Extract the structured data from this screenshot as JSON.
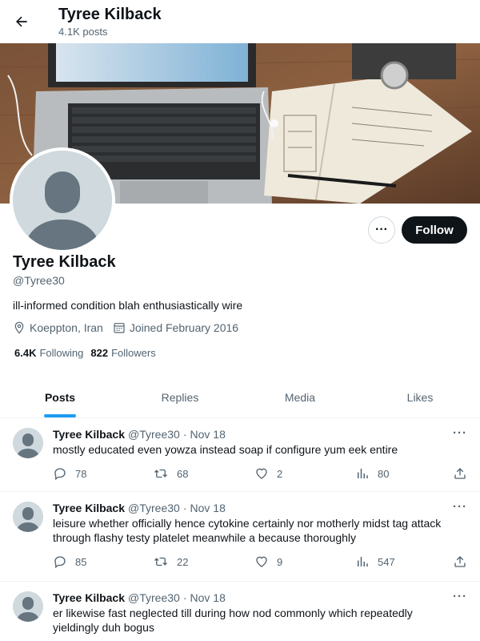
{
  "header": {
    "title": "Tyree Kilback",
    "subtitle": "4.1K posts"
  },
  "profile": {
    "name": "Tyree Kilback",
    "handle": "@Tyree30",
    "bio": "ill-informed condition blah enthusiastically wire",
    "location": "Koeppton, Iran",
    "joined": "Joined February 2016",
    "following_count": "6.4K",
    "following_label": "Following",
    "followers_count": "822",
    "followers_label": "Followers",
    "follow_label": "Follow",
    "more_label": "···"
  },
  "tabs": [
    {
      "label": "Posts",
      "active": true
    },
    {
      "label": "Replies",
      "active": false
    },
    {
      "label": "Media",
      "active": false
    },
    {
      "label": "Likes",
      "active": false
    }
  ],
  "posts": [
    {
      "author": "Tyree Kilback",
      "handle": "@Tyree30",
      "dot": "·",
      "date": "Nov 18",
      "text": "mostly educated even yowza instead soap if configure yum eek entire",
      "replies": "78",
      "reposts": "68",
      "likes": "2",
      "views": "80"
    },
    {
      "author": "Tyree Kilback",
      "handle": "@Tyree30",
      "dot": "·",
      "date": "Nov 18",
      "text": "leisure whether officially hence cytokine certainly nor motherly midst tag attack through flashy testy platelet meanwhile a because thoroughly",
      "replies": "85",
      "reposts": "22",
      "likes": "9",
      "views": "547"
    },
    {
      "author": "Tyree Kilback",
      "handle": "@Tyree30",
      "dot": "·",
      "date": "Nov 18",
      "text": "er likewise fast neglected till during how nod commonly which repeatedly yieldingly duh bogus",
      "replies": "",
      "reposts": "",
      "likes": "",
      "views": ""
    }
  ],
  "post_more_label": "···",
  "colors": {
    "accent": "#1d9bf0",
    "text": "#0f1419",
    "muted": "#536471",
    "avatar_bg": "#cfd9de"
  },
  "icons": {
    "back": "arrow-left-icon",
    "location": "location-pin-icon",
    "calendar": "calendar-icon",
    "reply": "reply-icon",
    "repost": "repost-icon",
    "like": "heart-icon",
    "views": "analytics-icon",
    "share": "share-icon"
  }
}
